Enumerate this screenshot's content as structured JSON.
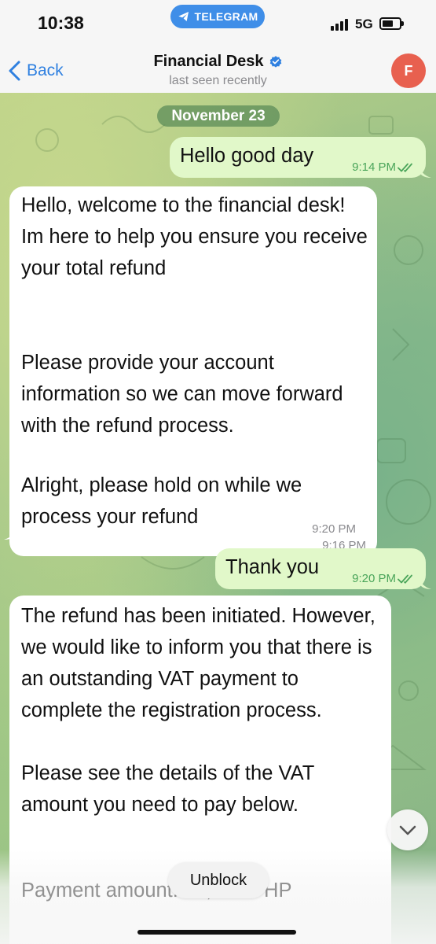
{
  "status_bar": {
    "time": "10:38",
    "pill_label": "TELEGRAM",
    "network": "5G",
    "battery_level": 0.65
  },
  "header": {
    "back_label": "Back",
    "title": "Financial Desk",
    "verified": true,
    "subtitle": "last seen recently",
    "avatar_initial": "F",
    "avatar_color": "#e8604f"
  },
  "chat": {
    "date_label": "November 23",
    "messages": [
      {
        "direction": "out",
        "text": "Hello good day",
        "time": "9:14 PM",
        "read": true
      },
      {
        "direction": "in",
        "text": "Hello, welcome to the financial desk! Im here to help you ensure you receive your total refund\n\n\nPlease provide your account information so we can move forward with the refund process.",
        "time": "9:16 PM"
      },
      {
        "direction": "in",
        "text": "Alright, please hold on while we process your refund",
        "time": "9:20 PM"
      },
      {
        "direction": "out",
        "text": "Thank you",
        "time": "9:20 PM",
        "read": true
      },
      {
        "direction": "in",
        "text": "The refund has been initiated. However, we would like to inform you that there is an outstanding VAT payment to complete the registration process.\n\nPlease see the details of the VAT amount you need to pay below.",
        "time": ""
      }
    ],
    "partial_line": "Payment amount: 10,000 PHP"
  },
  "footer": {
    "unblock_label": "Unblock"
  },
  "colors": {
    "accent": "#2f80e0",
    "outgoing_bubble": "#e1f8c9",
    "incoming_bubble": "#ffffff",
    "read_check": "#4aa55a"
  },
  "icons": {
    "back": "chevron-left-icon",
    "verified": "verified-badge-icon",
    "scroll": "chevron-down-icon",
    "read": "double-check-icon",
    "telegram": "paper-plane-icon"
  }
}
